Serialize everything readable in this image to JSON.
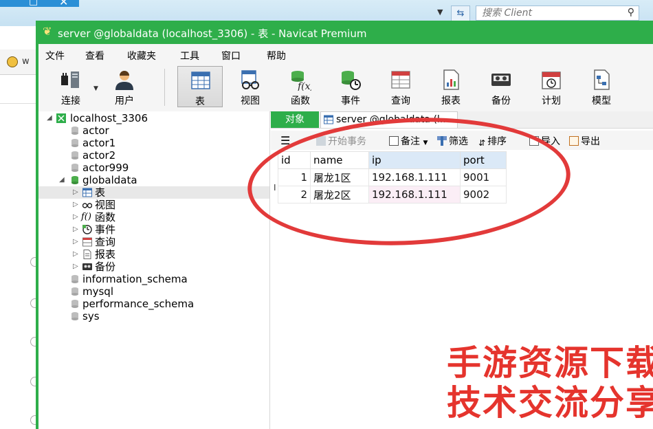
{
  "background_window": {
    "search_placeholder": "搜索 Client",
    "tab_label": "w"
  },
  "window": {
    "title": "server @globaldata (localhost_3306) - 表 - Navicat Premium",
    "accent_color": "#2eae4a"
  },
  "menu": [
    "文件",
    "查看",
    "收藏夹",
    "工具",
    "窗口",
    "帮助"
  ],
  "toolbar": [
    {
      "label": "连接",
      "icon": "connection-icon"
    },
    {
      "label": "用户",
      "icon": "user-icon"
    },
    {
      "label": "表",
      "icon": "table-icon",
      "active": true
    },
    {
      "label": "视图",
      "icon": "view-icon"
    },
    {
      "label": "函数",
      "icon": "function-icon"
    },
    {
      "label": "事件",
      "icon": "event-icon"
    },
    {
      "label": "查询",
      "icon": "query-icon"
    },
    {
      "label": "报表",
      "icon": "report-icon"
    },
    {
      "label": "备份",
      "icon": "backup-icon"
    },
    {
      "label": "计划",
      "icon": "schedule-icon"
    },
    {
      "label": "模型",
      "icon": "model-icon"
    }
  ],
  "tree": {
    "connection": "localhost_3306",
    "databases": [
      "actor",
      "actor1",
      "actor2",
      "actor999",
      "globaldata"
    ],
    "globaldata_children": [
      "表",
      "视图",
      "函数",
      "事件",
      "查询",
      "报表",
      "备份"
    ],
    "function_prefix": "f()",
    "other_databases": [
      "information_schema",
      "mysql",
      "performance_schema",
      "sys"
    ]
  },
  "tabs": {
    "objects": "对象",
    "server_tab": "server @globaldata (l..."
  },
  "grid_toolbar": {
    "begin_transaction": "开始事务",
    "memo": "备注",
    "filter": "筛选",
    "sort": "排序",
    "import": "导入",
    "export": "导出"
  },
  "table": {
    "columns": [
      "id",
      "name",
      "ip",
      "port"
    ],
    "rows": [
      [
        "1",
        "屠龙1区",
        "192.168.1.111",
        "9001"
      ],
      [
        "2",
        "屠龙2区",
        "192.168.1.111",
        "9002"
      ]
    ],
    "row_cursor": "I"
  },
  "watermark": {
    "line1": "手游资源下载",
    "line2": "技术交流分享",
    "color": "#e5342d"
  }
}
